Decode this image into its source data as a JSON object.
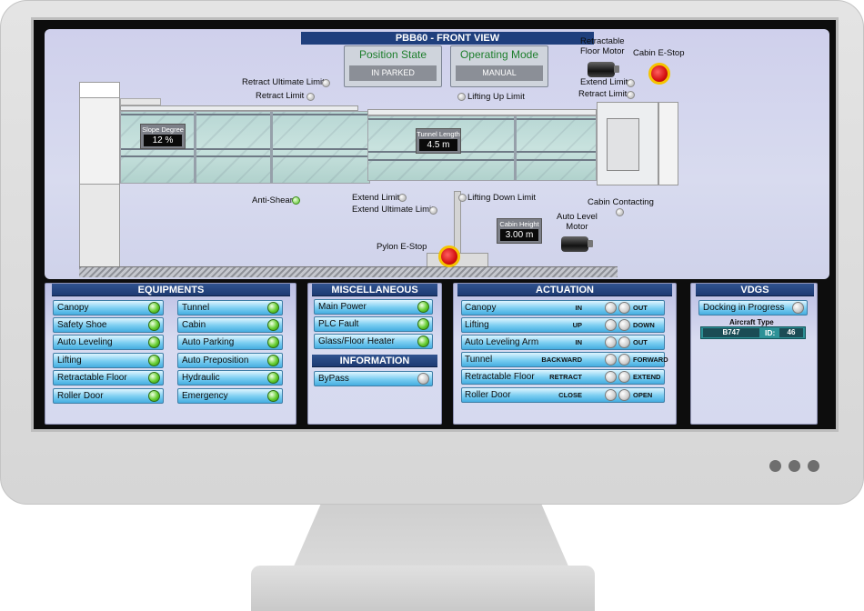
{
  "view": {
    "title": "PBB60    - FRONT VIEW",
    "position_state": {
      "label": "Position State",
      "value": "IN PARKED"
    },
    "operating_mode": {
      "label": "Operating Mode",
      "value": "MANUAL"
    },
    "labels": {
      "retract_ultimate_limit": "Retract Ultimate Limit",
      "retract_limit": "Retract Limit",
      "lifting_up_limit": "Lifting Up Limit",
      "retractable_floor_motor": "Retractable\nFloor Motor",
      "cabin_estop": "Cabin E-Stop",
      "cabin_extend_limit": "Extend Limit",
      "cabin_retract_limit": "Retract Limit",
      "anti_shear": "Anti-Shear",
      "extend_limit": "Extend Limit",
      "extend_ultimate_limit": "Extend Ultimate Limit",
      "lifting_down_limit": "Lifting Down Limit",
      "cabin_contacting": "Cabin Contacting",
      "auto_level_motor": "Auto Level\nMotor",
      "pylon_estop": "Pylon E-Stop"
    },
    "readouts": {
      "slope_degree": {
        "label": "Slope Degree",
        "value": "12 %"
      },
      "tunnel_length": {
        "label": "Tunnel Length",
        "value": "4.5 m"
      },
      "cabin_height": {
        "label": "Cabin Height",
        "value": "3.00 m"
      }
    }
  },
  "equipments": {
    "title": "EQUIPMENTS",
    "left": [
      "Canopy",
      "Safety Shoe",
      "Auto Leveling",
      "Lifting",
      "Retractable Floor",
      "Roller Door"
    ],
    "right": [
      "Tunnel",
      "Cabin",
      "Auto Parking",
      "Auto Preposition",
      "Hydraulic",
      "Emergency"
    ]
  },
  "misc": {
    "title": "MISCELLANEOUS",
    "items": [
      "Main Power",
      "PLC Fault",
      "Glass/Floor Heater"
    ]
  },
  "information": {
    "title": "INFORMATION",
    "items": [
      "ByPass"
    ]
  },
  "actuation": {
    "title": "ACTUATION",
    "rows": [
      {
        "name": "Canopy",
        "a": "IN",
        "b": "OUT"
      },
      {
        "name": "Lifting",
        "a": "UP",
        "b": "DOWN"
      },
      {
        "name": "Auto Leveling Arm",
        "a": "IN",
        "b": "OUT"
      },
      {
        "name": "Tunnel",
        "a": "BACKWARD",
        "b": "FORWARD"
      },
      {
        "name": "Retractable Floor",
        "a": "RETRACT",
        "b": "EXTEND"
      },
      {
        "name": "Roller Door",
        "a": "CLOSE",
        "b": "OPEN"
      }
    ]
  },
  "vdgs": {
    "title": "VDGS",
    "docking": "Docking in Progress",
    "aircraft_type_label": "Aircraft Type",
    "aircraft_type": "B747",
    "id_label": "ID:",
    "id_value": "46"
  }
}
